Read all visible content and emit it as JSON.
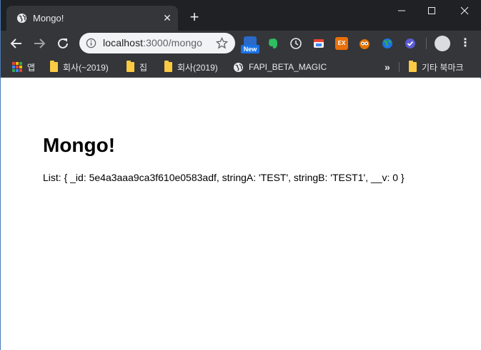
{
  "tab": {
    "title": "Mongo!",
    "favicon": "globe-icon"
  },
  "omnibox": {
    "host": "localhost",
    "path": ":3000/mongo"
  },
  "extensions": {
    "new_badge": "New"
  },
  "bookmarks": [
    {
      "label": "앱",
      "icon": "apps-grid-icon"
    },
    {
      "label": "회사(~2019)",
      "icon": "folder-icon"
    },
    {
      "label": "집",
      "icon": "folder-icon"
    },
    {
      "label": "회사(2019)",
      "icon": "folder-icon"
    },
    {
      "label": "FAPI_BETA_MAGIC",
      "icon": "globe-icon"
    }
  ],
  "bookmarks_overflow": "»",
  "other_bookmarks": "기타 북마크",
  "page": {
    "heading": "Mongo!",
    "list_text": "List: { _id: 5e4a3aaa9ca3f610e0583adf, stringA: 'TEST', stringB: 'TEST1', __v: 0 }"
  },
  "colors": {
    "titlebar": "#202124",
    "toolbar": "#35363a",
    "omnibox": "#f1f3f4",
    "folder": "#fbcb43"
  }
}
